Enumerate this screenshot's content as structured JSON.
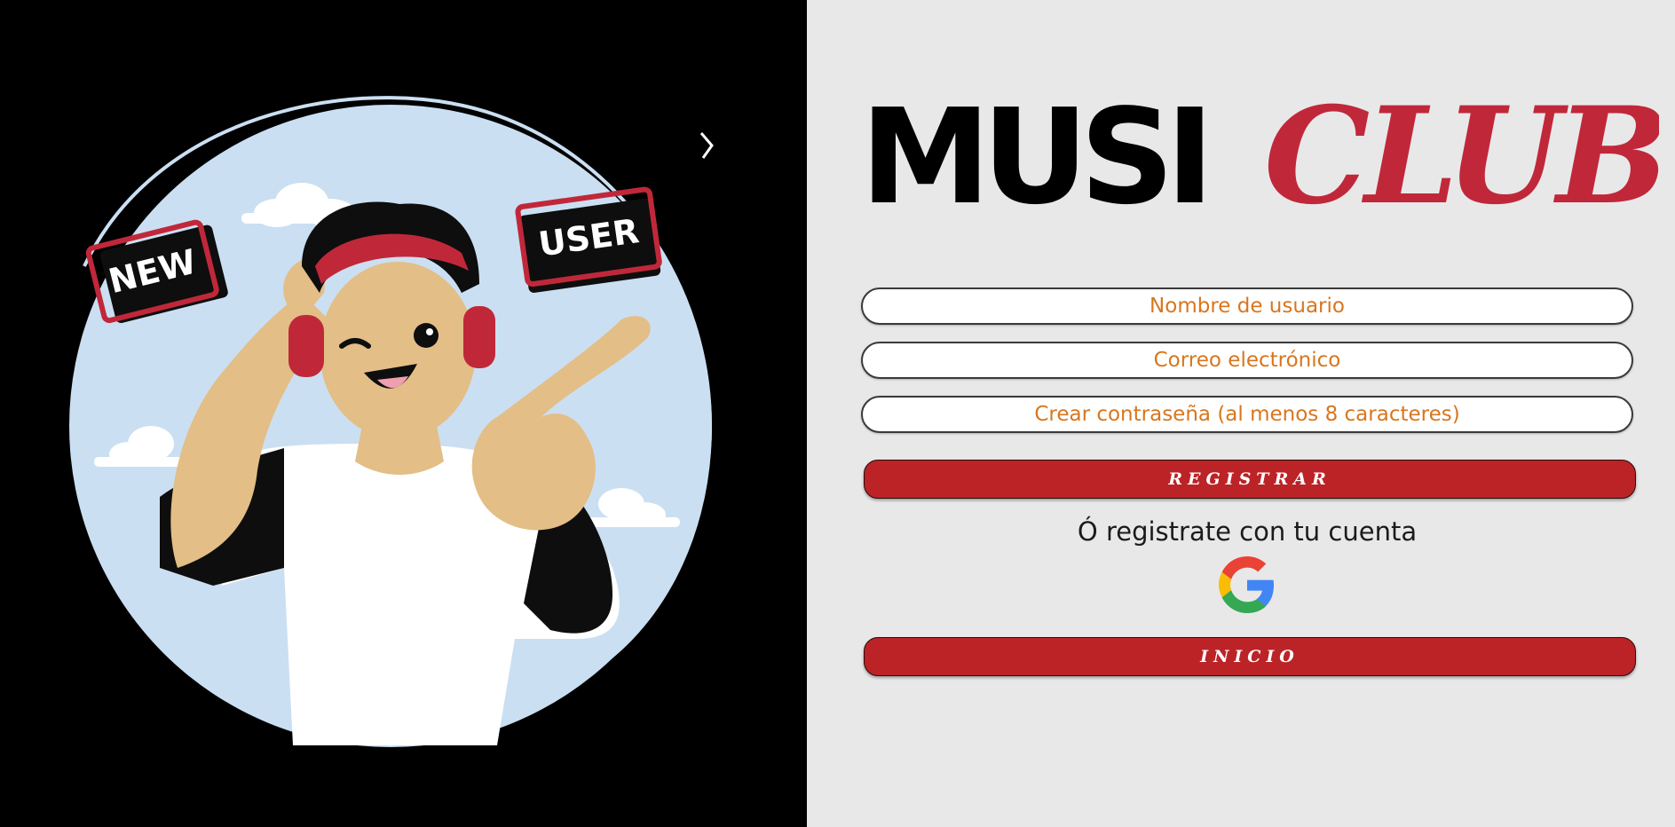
{
  "illustration": {
    "badge_new": "NEW",
    "badge_user": "USER"
  },
  "logo": {
    "part1": "MUSI",
    "part2": "CLUB"
  },
  "form": {
    "username_placeholder": "Nombre de usuario",
    "email_placeholder": "Correo electrónico",
    "password_placeholder": "Crear contraseña (al menos 8 caracteres)",
    "register_label": "REGISTRAR",
    "alt_signup_text": "Ó registrate con tu cuenta",
    "google_icon": "google-icon",
    "login_label": "INICIO"
  },
  "colors": {
    "left_background": "#000000",
    "right_background": "#e9e8e9",
    "brand_red": "#bb2327",
    "logo_red": "#c0283a",
    "placeholder_orange": "#d8761e",
    "circle_sky": "#cbdff2"
  }
}
